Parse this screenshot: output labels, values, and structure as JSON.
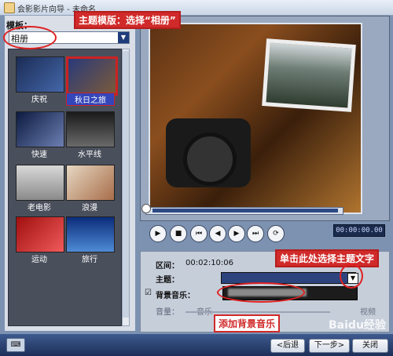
{
  "window": {
    "title": "会影影片向导 - 未命名"
  },
  "left": {
    "template_label": "模板：",
    "template_select_value": "相册",
    "thumbs": [
      {
        "label": "庆祝",
        "selected": false
      },
      {
        "label": "秋日之旅",
        "selected": true
      },
      {
        "label": "快速",
        "selected": false
      },
      {
        "label": "水平线",
        "selected": false
      },
      {
        "label": "老电影",
        "selected": false
      },
      {
        "label": "浪漫",
        "selected": false
      },
      {
        "label": "运动",
        "selected": false
      },
      {
        "label": "旅行",
        "selected": false
      }
    ]
  },
  "preview": {
    "timecode": "00:00:00.00"
  },
  "settings": {
    "interval_label": "区间：",
    "interval_value": "00:02:10:06",
    "theme_label": "主题：",
    "bgm_label": "背景音乐：",
    "volume_label": "音量：",
    "music_label": "音乐",
    "video_label": "视频"
  },
  "callouts": {
    "top": "主题模版：选择“相册”",
    "right": "单击此处选择主题文字",
    "bottom": "添加背景音乐"
  },
  "footer": {
    "back": "<后退",
    "next": "下一步>",
    "close": "关闭"
  },
  "watermark": "Baidu经验",
  "colors": {
    "accent_red": "#d12a2a",
    "selection_blue": "#3446b8"
  }
}
